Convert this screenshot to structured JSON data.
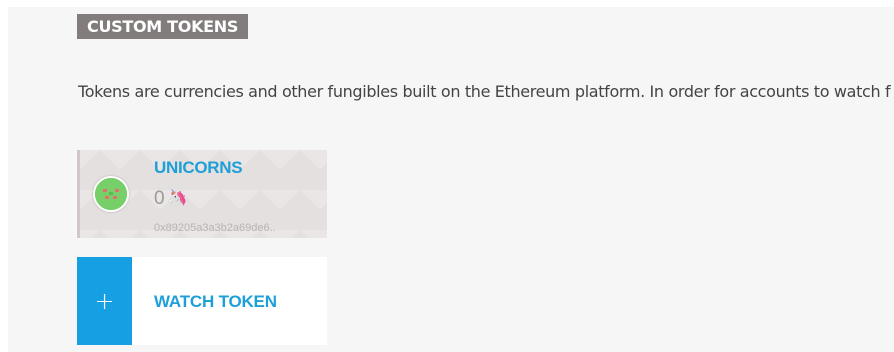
{
  "section": {
    "title": "CUSTOM TOKENS",
    "description": "Tokens are currencies and other fungibles built on the Ethereum platform. In order for accounts to watch f"
  },
  "tokens": [
    {
      "name": "UNICORNS",
      "balance": "0",
      "symbol_icon": "🦄",
      "address": "0x89205a3a3b2a69de6..",
      "identicon_color": "#77cf6a"
    }
  ],
  "actions": {
    "watch_plus": "+",
    "watch_label": "WATCH TOKEN"
  },
  "colors": {
    "accent": "#16a0e3",
    "link_text": "#1f9fd8",
    "title_bg": "#827c7c"
  }
}
